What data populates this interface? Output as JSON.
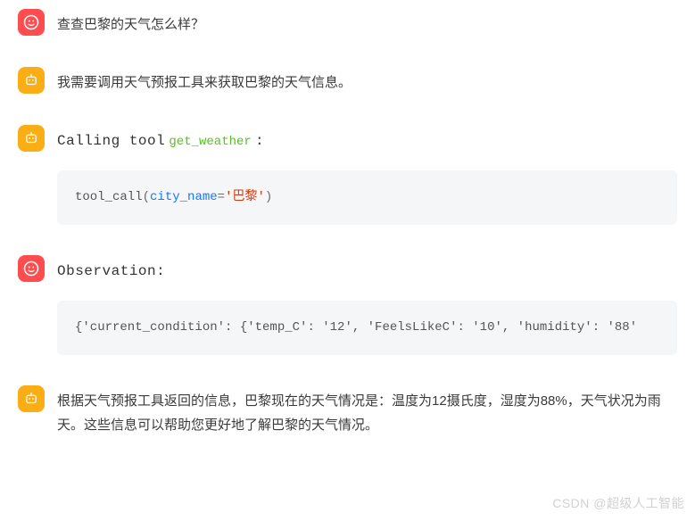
{
  "messages": {
    "user_query": "查查巴黎的天气怎么样？",
    "assistant_thought": "我需要调用天气预报工具来获取巴黎的天气信息。",
    "calling": {
      "prefix": "Calling tool",
      "tool_name": "get_weather",
      "suffix": ":",
      "code": {
        "fn": "tool_call",
        "arg_key": "city_name",
        "arg_val": "'巴黎'"
      }
    },
    "observation": {
      "title": "Observation:",
      "body": "{'current_condition': {'temp_C': '12', 'FeelsLikeC': '10', 'humidity': '88'"
    },
    "assistant_answer": "根据天气预报工具返回的信息，巴黎现在的天气情况是：温度为12摄氏度，湿度为88%，天气状况为雨天。这些信息可以帮助您更好地了解巴黎的天气情况。"
  },
  "watermark": "CSDN @超级人工智能"
}
